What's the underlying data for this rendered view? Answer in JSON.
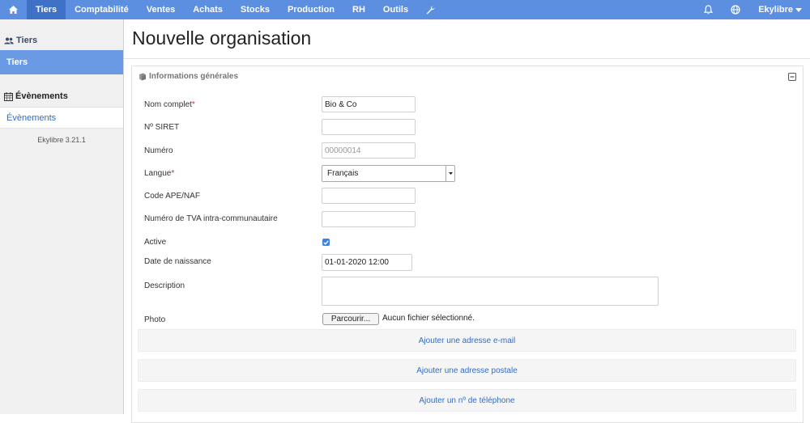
{
  "nav": {
    "items": [
      {
        "label": "Tiers"
      },
      {
        "label": "Comptabilité"
      },
      {
        "label": "Ventes"
      },
      {
        "label": "Achats"
      },
      {
        "label": "Stocks"
      },
      {
        "label": "Production"
      },
      {
        "label": "RH"
      },
      {
        "label": "Outils"
      }
    ],
    "user_label": "Ekylibre",
    "icons": [
      "home-icon",
      "wrench-icon",
      "bell-icon",
      "globe-icon",
      "caret-down-icon"
    ]
  },
  "sidebar": {
    "section1_title": "Tiers",
    "section1_item": "Tiers",
    "section2_title": "Évènements",
    "section2_item": "Évènements",
    "version": "Ekylibre 3.21.1"
  },
  "page": {
    "title": "Nouvelle organisation",
    "panel_title": "Informations générales"
  },
  "form": {
    "full_name_label": "Nom complet",
    "full_name_value": "Bio & Co",
    "siret_label": "Nº SIRET",
    "number_label": "Numéro",
    "number_placeholder": "00000014",
    "language_label": "Langue",
    "language_value": "Français",
    "ape_label": "Code APE/NAF",
    "vat_label": "Numéro de TVA intra-communautaire",
    "active_label": "Active",
    "active_checked": true,
    "birthdate_label": "Date de naissance",
    "birthdate_value": "01-01-2020 12:00",
    "description_label": "Description",
    "photo_label": "Photo",
    "browse_button": "Parcourir...",
    "no_file_text": "Aucun fichier sélectionné."
  },
  "actions": {
    "add_email": "Ajouter une adresse e-mail",
    "add_postal": "Ajouter une adresse postale",
    "add_phone": "Ajouter un nº de téléphone"
  },
  "colors": {
    "nav_bg": "#5d8fe0",
    "nav_active": "#3f72c6",
    "link": "#2f6cc7",
    "required": "#dd2233"
  }
}
